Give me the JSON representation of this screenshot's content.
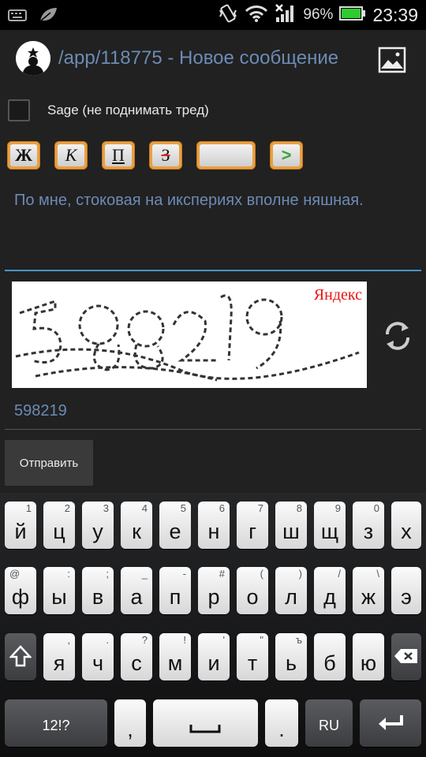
{
  "status_bar": {
    "battery": "96%",
    "time": "23:39",
    "icons": [
      "keyboard-icon",
      "leaf-icon",
      "vibrate-icon",
      "wifi-icon",
      "signal-icon",
      "battery-icon"
    ]
  },
  "action_bar": {
    "title": "/app/118775 - Новое сообщение",
    "logo_icon": "anonymous-logo-icon",
    "attach_icon": "image-icon"
  },
  "form": {
    "sage_label": "Sage (не поднимать тред)",
    "sage_checked": false,
    "format_buttons": [
      "Ж",
      "К",
      "П",
      "З",
      "",
      ">"
    ],
    "message": "По мне, стоковая на икспериях вполне няшная.",
    "captcha_brand": "Яндекс",
    "captcha_value": "598219",
    "send_label": "Отправить",
    "refresh_icon": "refresh-icon"
  },
  "keyboard": {
    "row1": [
      {
        "k": "й",
        "h": "1"
      },
      {
        "k": "ц",
        "h": "2"
      },
      {
        "k": "у",
        "h": "3"
      },
      {
        "k": "к",
        "h": "4"
      },
      {
        "k": "е",
        "h": "5"
      },
      {
        "k": "н",
        "h": "6"
      },
      {
        "k": "г",
        "h": "7"
      },
      {
        "k": "ш",
        "h": "8"
      },
      {
        "k": "щ",
        "h": "9"
      },
      {
        "k": "з",
        "h": "0"
      },
      {
        "k": "х",
        "h": ""
      }
    ],
    "row2": [
      {
        "k": "ф",
        "h": "@"
      },
      {
        "k": "ы",
        "h": ":"
      },
      {
        "k": "в",
        "h": ";"
      },
      {
        "k": "а",
        "h": "_"
      },
      {
        "k": "п",
        "h": "-"
      },
      {
        "k": "р",
        "h": "#"
      },
      {
        "k": "о",
        "h": "("
      },
      {
        "k": "л",
        "h": ")"
      },
      {
        "k": "д",
        "h": "/"
      },
      {
        "k": "ж",
        "h": "\\"
      },
      {
        "k": "э",
        "h": ""
      }
    ],
    "row3": [
      {
        "k": "я",
        "h": ","
      },
      {
        "k": "ч",
        "h": "."
      },
      {
        "k": "с",
        "h": "?"
      },
      {
        "k": "м",
        "h": "!"
      },
      {
        "k": "и",
        "h": "'"
      },
      {
        "k": "т",
        "h": "\""
      },
      {
        "k": "ь",
        "h": "ъ"
      },
      {
        "k": "б",
        "h": ""
      },
      {
        "k": "ю",
        "h": ""
      }
    ],
    "shift_icon": "shift-icon",
    "backspace_icon": "backspace-icon",
    "symbols_label": "12!?",
    "comma": ",",
    "period": ".",
    "lang_label": "RU",
    "space_icon": "space-icon",
    "enter_icon": "enter-icon"
  }
}
